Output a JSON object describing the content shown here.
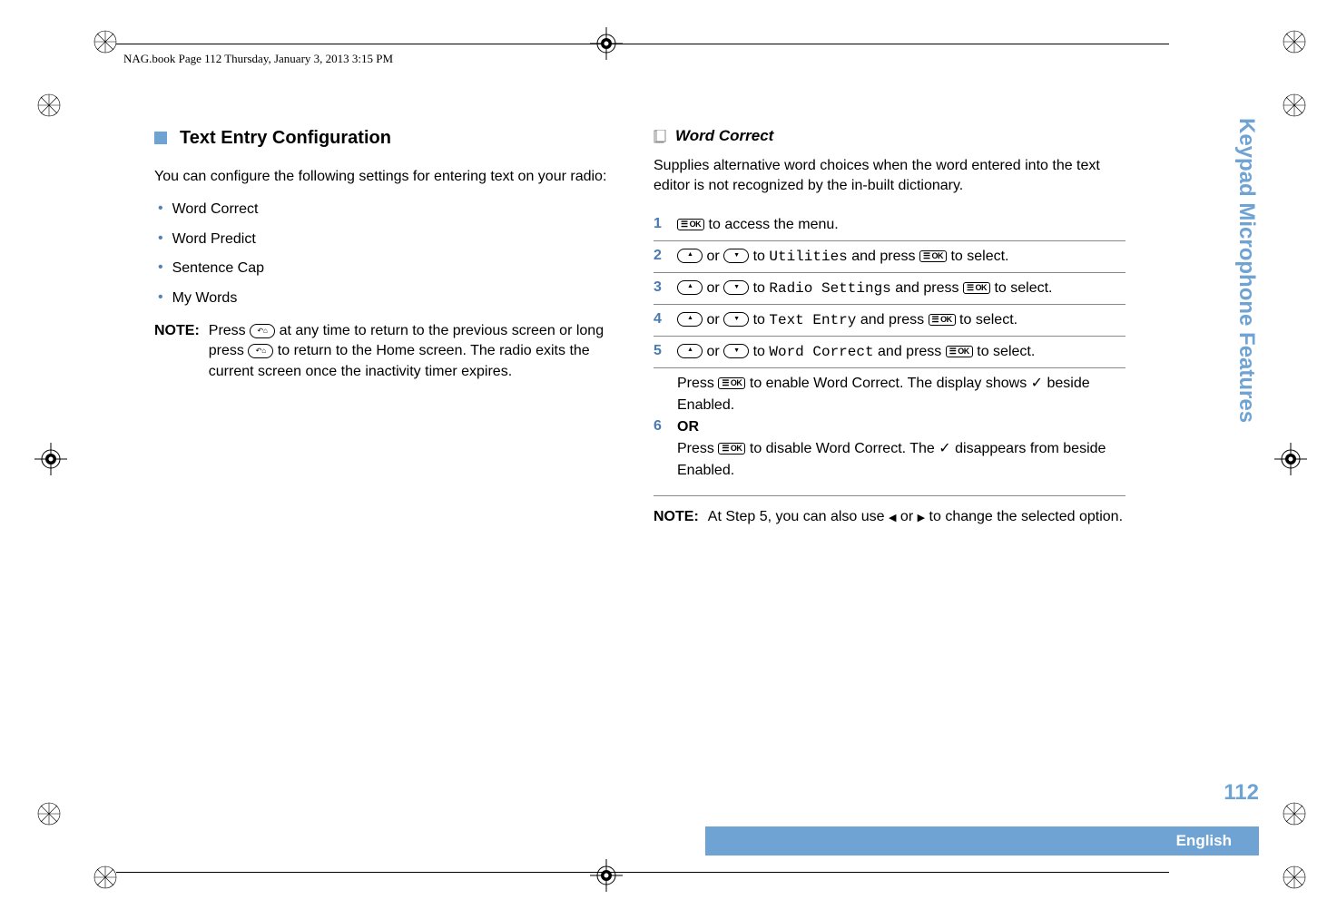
{
  "header": "NAG.book  Page 112  Thursday, January 3, 2013  3:15 PM",
  "left": {
    "title": "Text Entry Configuration",
    "intro": "You can configure the following settings for entering text on your radio:",
    "bullets": [
      "Word Correct",
      "Word Predict",
      "Sentence Cap",
      "My Words"
    ],
    "note_label": "NOTE:",
    "note_text_1": "Press ",
    "note_text_2": " at any time to return to the previous screen or long press ",
    "note_text_3": " to return to the Home screen. The radio exits the current screen once the inactivity timer expires."
  },
  "right": {
    "subtitle": "Word Correct",
    "intro": "Supplies alternative word choices when the word entered into the text editor is not recognized by the in-built dictionary.",
    "steps": {
      "s1a": " to access the menu.",
      "s2a": " or ",
      "s2b": " to ",
      "s2c": "Utilities",
      "s2d": " and press ",
      "s2e": " to select.",
      "s3c": "Radio Settings",
      "s4c": "Text Entry",
      "s5c": "Word Correct",
      "s6a": "Press ",
      "s6b": " to enable Word Correct. The display shows ",
      "s6c": " beside Enabled.",
      "s6or": "OR",
      "s6d": "Press ",
      "s6e": " to disable Word Correct. The ",
      "s6f": " disappears from beside Enabled."
    },
    "note_label": "NOTE:",
    "note_text_1": "At Step 5, you can also use ",
    "note_text_2": " or ",
    "note_text_3": " to change the selected option."
  },
  "side_tab": "Keypad Microphone Features",
  "page_num": "112",
  "footer": "English",
  "icons": {
    "ok": "☰ OK",
    "back": "↶⌂"
  }
}
